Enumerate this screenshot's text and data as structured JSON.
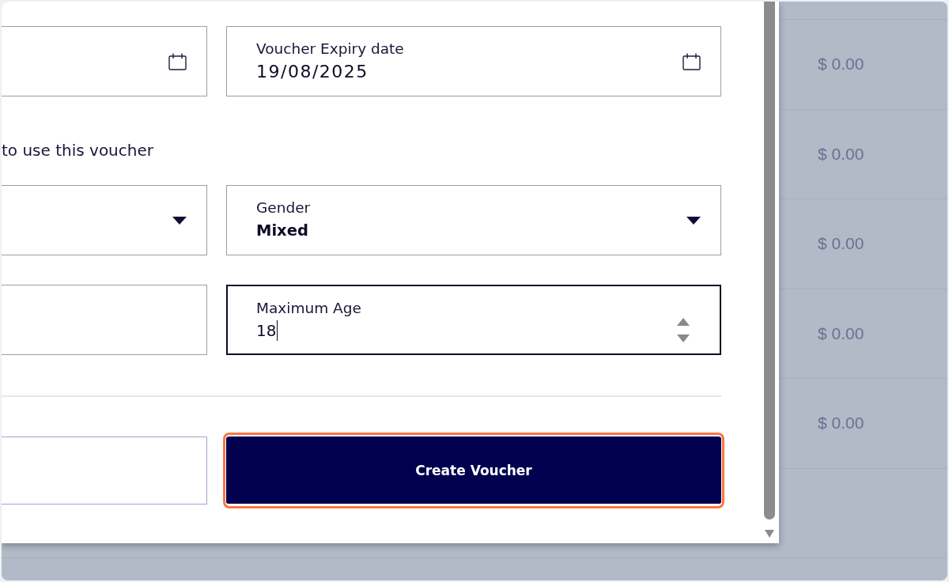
{
  "table": {
    "rows": [
      {
        "amount": "$ 0.00"
      },
      {
        "amount": "$ 0.00"
      },
      {
        "amount": "$ 0.00"
      },
      {
        "amount": "$ 0.00"
      },
      {
        "amount": "$ 0.00"
      }
    ]
  },
  "dialog": {
    "date_row": {
      "fields": [
        {
          "kind": "date",
          "focused": false
        },
        {
          "kind": "date",
          "label": "Voucher Expiry date",
          "value": "19/08/2025",
          "focused": false
        }
      ]
    },
    "section_title": "to use this voucher",
    "eligibility_rows": [
      {
        "fields": [
          {
            "kind": "select",
            "focused": false
          },
          {
            "kind": "select",
            "label": "Gender",
            "value": "Mixed",
            "focused": false
          }
        ]
      },
      {
        "fields": [
          {
            "kind": "text",
            "focused": false
          },
          {
            "kind": "number",
            "label": "Maximum Age",
            "value": "18",
            "focused": true
          }
        ]
      }
    ],
    "actions": [
      {
        "kind": "outline",
        "focused": false
      },
      {
        "kind": "primary",
        "label": "Create Voucher",
        "focused": true
      }
    ]
  }
}
